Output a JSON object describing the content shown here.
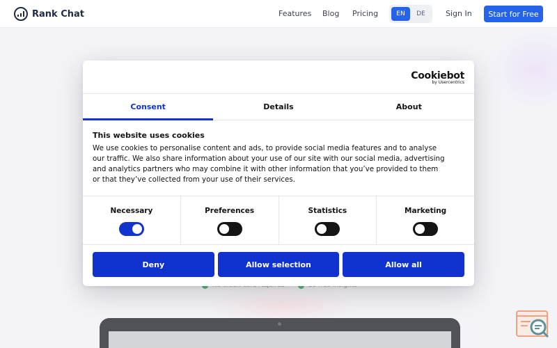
{
  "header": {
    "brand": "Rank Chat",
    "nav": [
      "Features",
      "Blog",
      "Pricing"
    ],
    "languages": [
      "EN",
      "DE"
    ],
    "active_language": "EN",
    "signin": "Sign In",
    "cta": "Start for Free",
    "accent_color": "#2563eb"
  },
  "hero": {
    "checks": [
      "No credit card required",
      "20 free insights"
    ]
  },
  "cookie_dialog": {
    "logo": "Cookiebot",
    "logo_sub": "by Usercentrics",
    "tabs": [
      "Consent",
      "Details",
      "About"
    ],
    "active_tab": "Consent",
    "title": "This website uses cookies",
    "text": "We use cookies to personalise content and ads, to provide social media features and to analyse our traffic. We also share information about your use of our site with our social media, advertising and analytics partners who may combine it with other information that you’ve provided to them or that they’ve collected from your use of their services.",
    "toggles": [
      {
        "label": "Necessary",
        "on": true
      },
      {
        "label": "Preferences",
        "on": false
      },
      {
        "label": "Statistics",
        "on": false
      },
      {
        "label": "Marketing",
        "on": false
      }
    ],
    "buttons": [
      "Deny",
      "Allow selection",
      "Allow all"
    ],
    "accent_color": "#1032cf"
  }
}
